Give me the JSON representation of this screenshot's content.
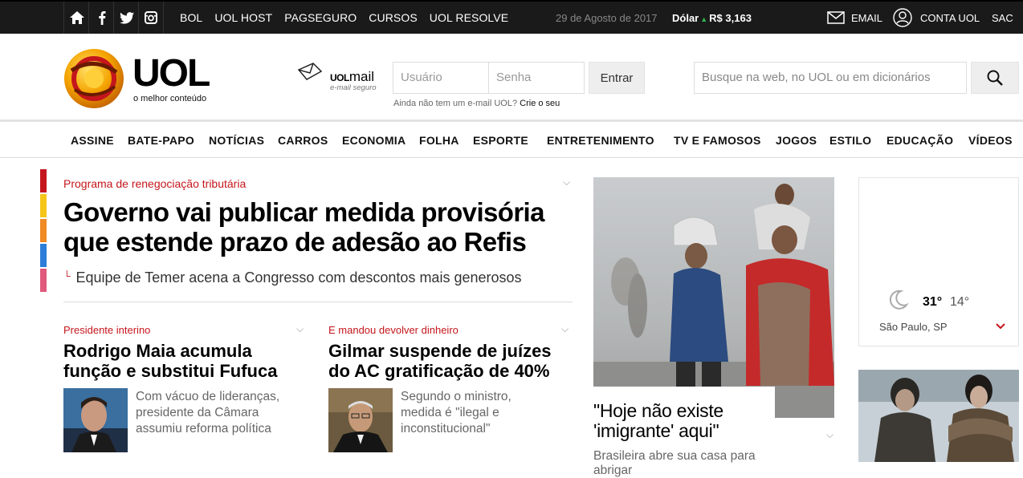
{
  "topbar": {
    "icons": [
      "home-icon",
      "facebook-icon",
      "twitter-icon",
      "instagram-icon"
    ],
    "links": [
      "BOL",
      "UOL HOST",
      "PAGSEGURO",
      "CURSOS",
      "UOL RESOLVE"
    ],
    "date": "29 de Agosto de 2017",
    "dolar_label": "Dólar",
    "dolar_value": "R$ 3,163",
    "email": "EMAIL",
    "conta": "CONTA UOL",
    "sac": "SAC"
  },
  "header": {
    "logo_text": "UOL",
    "logo_sub": "o melhor conteúdo",
    "mail_brand": "UOL",
    "mail_brand2": "mail",
    "mail_sub": "e-mail seguro",
    "user_placeholder": "Usuário",
    "pass_placeholder": "Senha",
    "enter": "Entrar",
    "signup_q": "Ainda não tem um e-mail UOL?",
    "signup_link": "Crie o seu",
    "search_placeholder": "Busque na web, no UOL ou em dicionários"
  },
  "nav": [
    "ASSINE",
    "BATE-PAPO",
    "NOTÍCIAS",
    "CARROS",
    "ECONOMIA",
    "FOLHA",
    "ESPORTE",
    "ENTRETENIMENTO",
    "TV E FAMOSOS",
    "JOGOS",
    "ESTILO",
    "EDUCAÇÃO",
    "VÍDEOS"
  ],
  "colors": {
    "red": "#c4161c",
    "bar_colors": [
      "#c4161c",
      "#f5c518",
      "#f08a24",
      "#2d7ed8",
      "#e05a7c"
    ]
  },
  "main": {
    "kicker": "Programa de renegociação tributária",
    "headline1": "Governo vai publicar medida provisória",
    "headline2": "que estende prazo de adesão ao Refis",
    "sub": "Equipe de Temer acena a Congresso com descontos mais generosos"
  },
  "stories": [
    {
      "kicker": "Presidente interino",
      "title1": "Rodrigo Maia acumula",
      "title2": "função e substitui Fufuca",
      "text1": "Com vácuo de lideranças,",
      "text2": "presidente da Câmara",
      "text3": "assumiu reforma política"
    },
    {
      "kicker": "E mandou devolver dinheiro",
      "title1": "Gilmar suspende de juízes",
      "title2": "do AC gratificação de 40%",
      "text1": "Segundo o ministro,",
      "text2": "medida é \"ilegal e",
      "text3": "inconstitucional\""
    }
  ],
  "feature": {
    "title1": "\"Hoje não existe",
    "title2": "'imigrante' aqui\"",
    "sub": "Brasileira abre sua casa para abrigar"
  },
  "weather": {
    "max": "31°",
    "min": "14°",
    "city": "São Paulo, SP"
  }
}
